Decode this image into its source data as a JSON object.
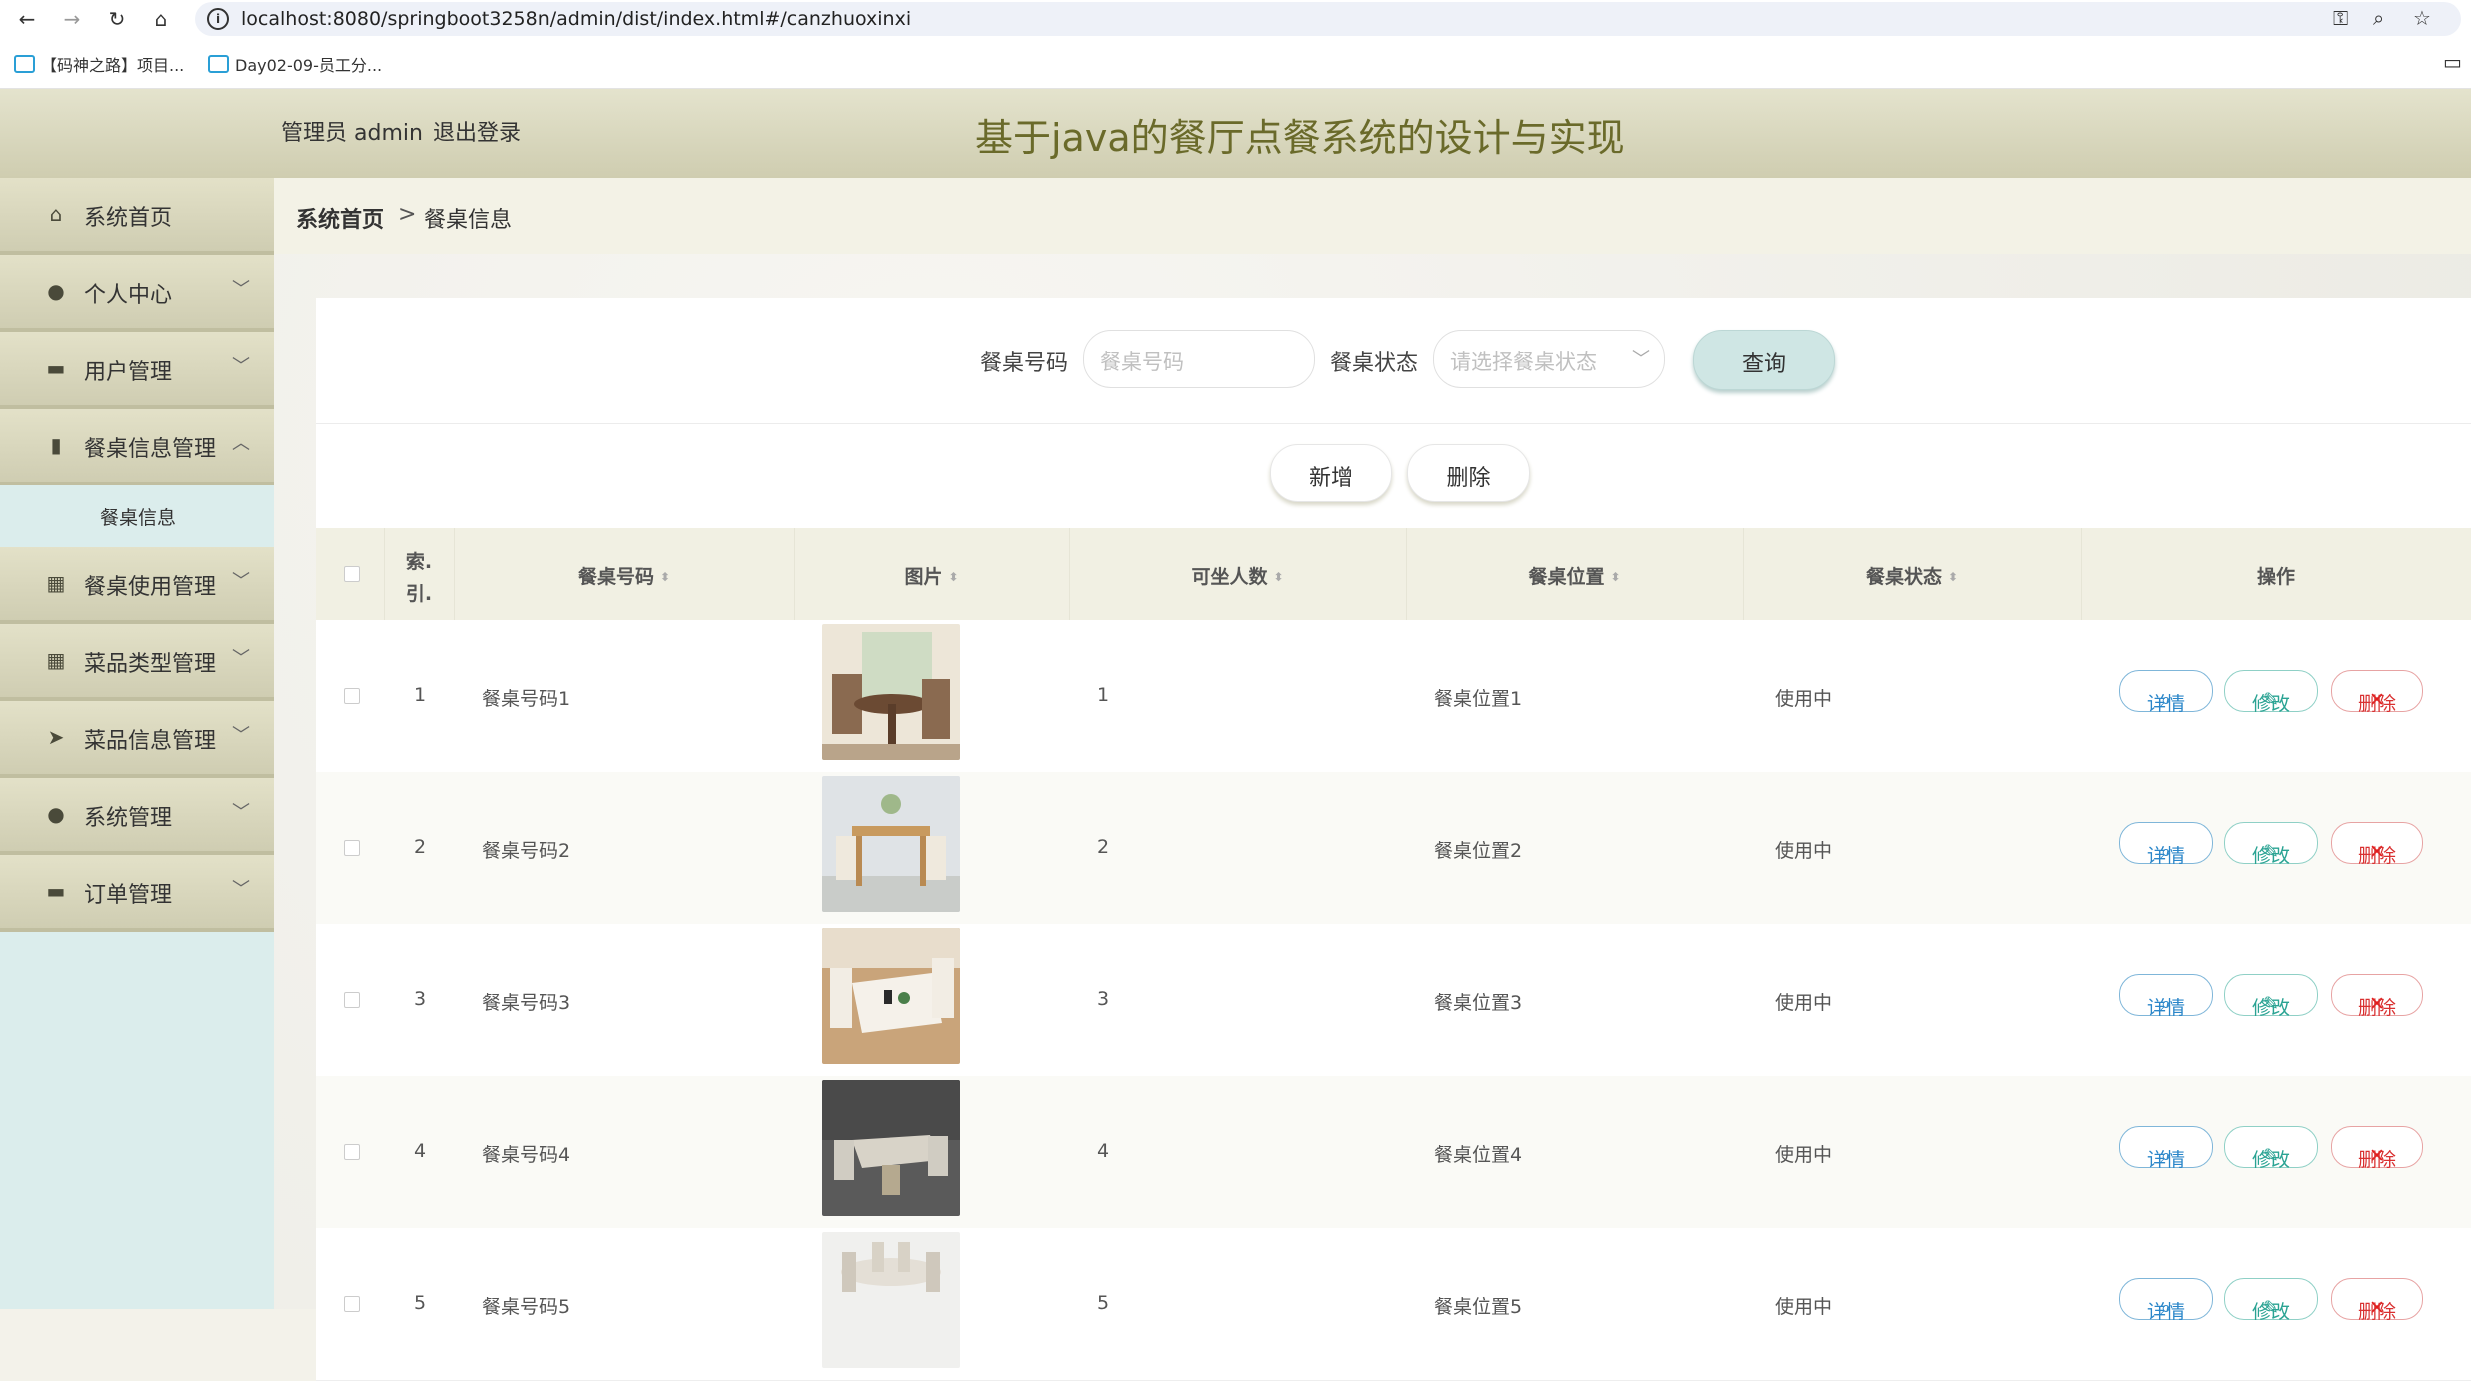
{
  "browser": {
    "url": "localhost:8080/springboot3258n/admin/dist/index.html#/canzhuoxinxi",
    "bookmarks": [
      "【码神之路】项目...",
      "Day02-09-员工分..."
    ]
  },
  "header": {
    "admin_label": "管理员 admin",
    "logout_label": "退出登录",
    "title": "基于java的餐厅点餐系统的设计与实现"
  },
  "sidebar": {
    "items": [
      {
        "label": "系统首页",
        "icon": "home-icon",
        "arrow": ""
      },
      {
        "label": "个人中心",
        "icon": "person-icon",
        "arrow": "﹀"
      },
      {
        "label": "用户管理",
        "icon": "ticket-icon",
        "arrow": "﹀"
      },
      {
        "label": "餐桌信息管理",
        "icon": "book-icon",
        "arrow": "︿"
      },
      {
        "label": "餐桌使用管理",
        "icon": "grid-icon",
        "arrow": "﹀"
      },
      {
        "label": "菜品类型管理",
        "icon": "grid-icon",
        "arrow": "﹀"
      },
      {
        "label": "菜品信息管理",
        "icon": "send-icon",
        "arrow": "﹀"
      },
      {
        "label": "系统管理",
        "icon": "person-icon",
        "arrow": "﹀"
      },
      {
        "label": "订单管理",
        "icon": "monitor-icon",
        "arrow": "﹀"
      }
    ],
    "submenu_label": "餐桌信息"
  },
  "breadcrumb": {
    "home": "系统首页",
    "separator": ">",
    "current": "餐桌信息"
  },
  "search": {
    "table_no_label": "餐桌号码",
    "table_no_placeholder": "餐桌号码",
    "status_label": "餐桌状态",
    "status_placeholder": "请选择餐桌状态",
    "query_button": "查询"
  },
  "actions": {
    "add_button": "新增",
    "delete_button": "删除"
  },
  "table": {
    "columns": [
      "索引",
      "餐桌号码",
      "图片",
      "可坐人数",
      "餐桌位置",
      "餐桌状态",
      "操作"
    ],
    "index_col_line1": "索.",
    "index_col_line2": "引.",
    "rows": [
      {
        "index": "1",
        "table_no": "餐桌号码1",
        "seats": "1",
        "location": "餐桌位置1",
        "status": "使用中"
      },
      {
        "index": "2",
        "table_no": "餐桌号码2",
        "seats": "2",
        "location": "餐桌位置2",
        "status": "使用中"
      },
      {
        "index": "3",
        "table_no": "餐桌号码3",
        "seats": "3",
        "location": "餐桌位置3",
        "status": "使用中"
      },
      {
        "index": "4",
        "table_no": "餐桌号码4",
        "seats": "4",
        "location": "餐桌位置4",
        "status": "使用中"
      },
      {
        "index": "5",
        "table_no": "餐桌号码5",
        "seats": "5",
        "location": "餐桌位置5",
        "status": "使用中"
      }
    ],
    "op_detail": "详情",
    "op_edit": "修改",
    "op_delete": "删除"
  },
  "colors": {
    "header_bg": "#d9d7bd",
    "sidebar_bg": "#dbedec",
    "title_color": "#6a6a2a",
    "accent_teal": "#cfe6e4"
  }
}
